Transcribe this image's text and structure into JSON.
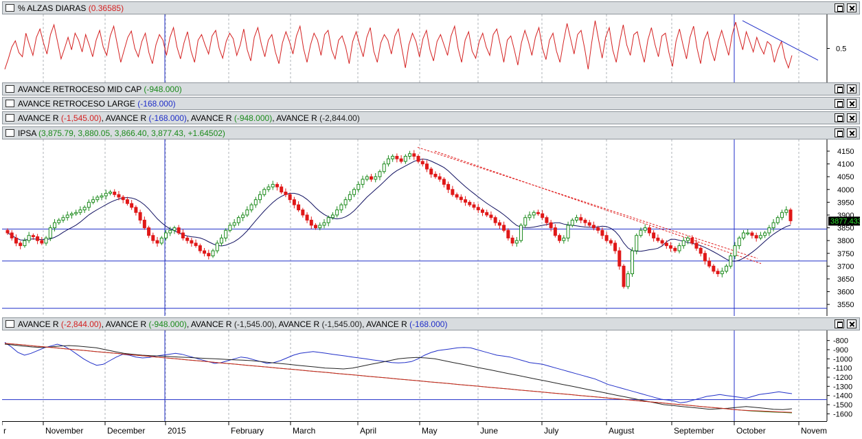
{
  "panes": {
    "alzas": {
      "check": "",
      "title_prefix": "% ",
      "title_name": "ALZAS DIARAS",
      "title_value": "(0.36585)",
      "axis_label": "0.5"
    },
    "mid": {
      "title_name": "AVANCE RETROCESO MID CAP",
      "title_value": "(-948.000)"
    },
    "large": {
      "title_name": "AVANCE RETROCESO LARGE",
      "title_value": "(-168.000)"
    },
    "multi": {
      "items": [
        {
          "name": "AVANCE R",
          "value": "(-1,545.00)",
          "color": "#d42020"
        },
        {
          "name": "AVANCE R",
          "value": "(-168.000)",
          "color": "#1f2ec8"
        },
        {
          "name": "AVANCE R",
          "value": "(-948.000)",
          "color": "#1b8a1b"
        },
        {
          "name": "AVANCE R",
          "value": "(-2,844.00)",
          "color": "#222222"
        }
      ]
    },
    "ipsa": {
      "title_name": "IPSA",
      "title_value": "(3,875.79, 3,880.05, 3,866.40, 3,877.43, +1.64502)",
      "last_price": "3877.433"
    },
    "avance": {
      "items": [
        {
          "name": "AVANCE R",
          "value": "(-2,844.00)",
          "color": "#d42020"
        },
        {
          "name": "AVANCE R",
          "value": "(-948.000)",
          "color": "#1b8a1b"
        },
        {
          "name": "AVANCE R",
          "value": "(-1,545.00)",
          "color": "#222222"
        },
        {
          "name": "AVANCE R",
          "value": "(-1,545.00)",
          "color": "#222222"
        },
        {
          "name": "AVANCE R",
          "value": "(-168.000)",
          "color": "#1f2ec8"
        }
      ]
    }
  },
  "x_axis": {
    "labels": [
      "r",
      "November",
      "December",
      "2015",
      "February",
      "March",
      "April",
      "May",
      "June",
      "July",
      "August",
      "September",
      "October",
      "Novem"
    ]
  },
  "colors": {
    "up": "#1b8a1b",
    "down": "#e01818",
    "ma": "#101060",
    "hline": "#1f2ec8",
    "trend": "#e02020"
  },
  "chart_data": [
    {
      "type": "line",
      "title": "% ALZAS DIARAS (0.36585)",
      "ylim": [
        0.05,
        0.95
      ],
      "yticks": [
        0.5
      ],
      "series": [
        {
          "name": "% ALZAS DIARAS",
          "color": "#d42020",
          "values": [
            0.2,
            0.35,
            0.52,
            0.61,
            0.44,
            0.38,
            0.72,
            0.55,
            0.4,
            0.66,
            0.78,
            0.58,
            0.42,
            0.7,
            0.84,
            0.6,
            0.35,
            0.5,
            0.66,
            0.48,
            0.72,
            0.62,
            0.45,
            0.7,
            0.55,
            0.38,
            0.62,
            0.76,
            0.52,
            0.4,
            0.68,
            0.82,
            0.56,
            0.3,
            0.48,
            0.66,
            0.75,
            0.5,
            0.38,
            0.6,
            0.72,
            0.44,
            0.28,
            0.55,
            0.7,
            0.62,
            0.4,
            0.66,
            0.8,
            0.52,
            0.35,
            0.58,
            0.74,
            0.46,
            0.3,
            0.62,
            0.7,
            0.55,
            0.42,
            0.68,
            0.76,
            0.5,
            0.36,
            0.6,
            0.72,
            0.64,
            0.4,
            0.55,
            0.78,
            0.48,
            0.32,
            0.66,
            0.8,
            0.56,
            0.38,
            0.62,
            0.7,
            0.45,
            0.28,
            0.58,
            0.74,
            0.6,
            0.42,
            0.68,
            0.82,
            0.5,
            0.3,
            0.55,
            0.72,
            0.62,
            0.4,
            0.7,
            0.76,
            0.48,
            0.35,
            0.62,
            0.68,
            0.52,
            0.28,
            0.6,
            0.74,
            0.55,
            0.38,
            0.66,
            0.8,
            0.46,
            0.3,
            0.58,
            0.7,
            0.62,
            0.42,
            0.68,
            0.78,
            0.5,
            0.22,
            0.55,
            0.72,
            0.6,
            0.38,
            0.64,
            0.76,
            0.48,
            0.32,
            0.6,
            0.7,
            0.55,
            0.4,
            0.68,
            0.82,
            0.5,
            0.3,
            0.62,
            0.74,
            0.46,
            0.36,
            0.6,
            0.72,
            0.52,
            0.4,
            0.7,
            0.78,
            0.55,
            0.3,
            0.62,
            0.68,
            0.48,
            0.26,
            0.58,
            0.76,
            0.6,
            0.4,
            0.66,
            0.8,
            0.5,
            0.34,
            0.62,
            0.72,
            0.46,
            0.3,
            0.6,
            0.86,
            0.64,
            0.42,
            0.7,
            0.76,
            0.5,
            0.2,
            0.58,
            0.9,
            0.62,
            0.36,
            0.66,
            0.8,
            0.48,
            0.3,
            0.6,
            0.84,
            0.55,
            0.4,
            0.7,
            0.74,
            0.5,
            0.3,
            0.62,
            0.8,
            0.56,
            0.38,
            0.68,
            0.72,
            0.44,
            0.24,
            0.6,
            0.78,
            0.55,
            0.35,
            0.66,
            0.82,
            0.5,
            0.28,
            0.62,
            0.74,
            0.48,
            0.32,
            0.6,
            0.76,
            0.58,
            0.4,
            0.7,
            0.88,
            0.66,
            0.48,
            0.74,
            0.6,
            0.45,
            0.66,
            0.52,
            0.42,
            0.6,
            0.55,
            0.3,
            0.48,
            0.6,
            0.36,
            0.22,
            0.4
          ]
        }
      ],
      "trendline": {
        "from": 0.9,
        "to": 0.45
      }
    },
    {
      "type": "candlestick",
      "title": "IPSA",
      "ylim": [
        3510,
        4185
      ],
      "yticks": [
        3550,
        3600,
        3650,
        3700,
        3750,
        3800,
        3850,
        3900,
        3950,
        4000,
        4050,
        4100,
        4150
      ],
      "hlines": [
        3845,
        3720,
        3535
      ],
      "close": [
        3830,
        3810,
        3790,
        3780,
        3800,
        3820,
        3815,
        3800,
        3790,
        3810,
        3850,
        3870,
        3880,
        3890,
        3900,
        3905,
        3910,
        3920,
        3930,
        3950,
        3960,
        3970,
        3975,
        3985,
        3990,
        3980,
        3970,
        3960,
        3945,
        3930,
        3910,
        3880,
        3850,
        3820,
        3800,
        3790,
        3810,
        3830,
        3840,
        3850,
        3830,
        3810,
        3800,
        3790,
        3780,
        3760,
        3750,
        3740,
        3760,
        3790,
        3810,
        3840,
        3860,
        3870,
        3890,
        3900,
        3920,
        3940,
        3960,
        3980,
        4000,
        4010,
        4020,
        4010,
        3990,
        3980,
        3960,
        3940,
        3920,
        3900,
        3880,
        3860,
        3850,
        3860,
        3870,
        3890,
        3900,
        3920,
        3940,
        3960,
        3980,
        4000,
        4020,
        4040,
        4050,
        4040,
        4050,
        4070,
        4100,
        4120,
        4130,
        4120,
        4110,
        4130,
        4140,
        4130,
        4110,
        4100,
        4080,
        4060,
        4050,
        4040,
        4020,
        4000,
        3980,
        3970,
        3960,
        3950,
        3940,
        3930,
        3920,
        3910,
        3900,
        3890,
        3870,
        3860,
        3840,
        3810,
        3790,
        3800,
        3860,
        3890,
        3900,
        3910,
        3905,
        3890,
        3870,
        3850,
        3820,
        3800,
        3810,
        3860,
        3880,
        3890,
        3880,
        3870,
        3860,
        3850,
        3840,
        3820,
        3800,
        3790,
        3760,
        3700,
        3620,
        3670,
        3760,
        3820,
        3840,
        3850,
        3830,
        3810,
        3800,
        3790,
        3780,
        3770,
        3760,
        3780,
        3800,
        3810,
        3790,
        3770,
        3750,
        3720,
        3700,
        3680,
        3670,
        3680,
        3700,
        3740,
        3780,
        3810,
        3830,
        3830,
        3820,
        3810,
        3820,
        3830,
        3850,
        3870,
        3890,
        3910,
        3920,
        3877.43
      ]
    },
    {
      "type": "line",
      "title": "AVANCE R",
      "ylim": [
        -1650,
        -720
      ],
      "yticks": [
        -800,
        -900,
        -1000,
        -1100,
        -1200,
        -1300,
        -1400,
        -1500,
        -1600
      ],
      "hlines": [
        -1445
      ],
      "series": [
        {
          "name": "AVANCE R",
          "color": "#1f2ec8",
          "values": [
            -820,
            -870,
            -930,
            -960,
            -940,
            -910,
            -880,
            -860,
            -840,
            -860,
            -900,
            -950,
            -1000,
            -1040,
            -1070,
            -1060,
            -1020,
            -980,
            -950,
            -960,
            -980,
            -990,
            -985,
            -970,
            -960,
            -950,
            -940,
            -950,
            -970,
            -990,
            -1010,
            -1030,
            -1050,
            -1040,
            -1020,
            -1000,
            -980,
            -990,
            -1010,
            -1030,
            -1050,
            -1040,
            -1020,
            -990,
            -960,
            -940,
            -930,
            -920,
            -930,
            -940,
            -950,
            -960,
            -970,
            -980,
            -990,
            -1000,
            -1010,
            -1020,
            -1030,
            -1040,
            -1045,
            -1040,
            -1030,
            -1000,
            -960,
            -930,
            -910,
            -900,
            -890,
            -880,
            -875,
            -880,
            -900,
            -920,
            -940,
            -960,
            -970,
            -980,
            -1000,
            -1020,
            -1040,
            -1050,
            -1060,
            -1080,
            -1100,
            -1120,
            -1140,
            -1160,
            -1180,
            -1200,
            -1220,
            -1250,
            -1280,
            -1300,
            -1320,
            -1340,
            -1360,
            -1380,
            -1400,
            -1420,
            -1440,
            -1450,
            -1460,
            -1480,
            -1470,
            -1450,
            -1430,
            -1410,
            -1400,
            -1390,
            -1400,
            -1410,
            -1420,
            -1430,
            -1410,
            -1390,
            -1380,
            -1370,
            -1360,
            -1370,
            -1380
          ]
        },
        {
          "name": "AVANCE R",
          "color": "#222222",
          "values": [
            -840,
            -850,
            -860,
            -870,
            -875,
            -870,
            -860,
            -855,
            -860,
            -870,
            -880,
            -900,
            -920,
            -940,
            -950,
            -960,
            -965,
            -970,
            -975,
            -980,
            -985,
            -990,
            -995,
            -1000,
            -1005,
            -1010,
            -1015,
            -1020,
            -1030,
            -1040,
            -1050,
            -1060,
            -1070,
            -1080,
            -1090,
            -1100,
            -1105,
            -1110,
            -1100,
            -1080,
            -1060,
            -1040,
            -1020,
            -1000,
            -990,
            -985,
            -990,
            -1000,
            -1020,
            -1040,
            -1060,
            -1080,
            -1100,
            -1120,
            -1140,
            -1160,
            -1180,
            -1200,
            -1220,
            -1240,
            -1260,
            -1280,
            -1300,
            -1320,
            -1340,
            -1360,
            -1380,
            -1400,
            -1420,
            -1440,
            -1460,
            -1480,
            -1500,
            -1510,
            -1520,
            -1530,
            -1540,
            -1550,
            -1545,
            -1540,
            -1530,
            -1520,
            -1530,
            -1540,
            -1550,
            -1555,
            -1545
          ]
        },
        {
          "name": "AVANCE R",
          "color": "#1b8a1b",
          "values": [
            -830,
            -840,
            -850,
            -860,
            -870,
            -880,
            -890,
            -900,
            -910,
            -920,
            -930,
            -940,
            -950,
            -960,
            -970,
            -980,
            -990,
            -1000,
            -1010,
            -1020,
            -1030,
            -1040,
            -1050,
            -1060,
            -1070,
            -1080,
            -1090,
            -1100,
            -1110,
            -1120,
            -1130,
            -1140,
            -1150,
            -1160,
            -1170,
            -1180,
            -1190,
            -1200,
            -1210,
            -1220,
            -1230,
            -1240,
            -1250,
            -1260,
            -1270,
            -1280,
            -1290,
            -1300,
            -1310,
            -1320,
            -1330,
            -1340,
            -1350,
            -1360,
            -1370,
            -1380,
            -1390,
            -1400,
            -1410,
            -1420,
            -1430,
            -1440,
            -1450,
            -1460,
            -1470,
            -1480,
            -1490,
            -1500,
            -1510,
            -1520,
            -1530,
            -1540,
            -1550,
            -1560,
            -1570,
            -1575,
            -1580,
            -1585,
            -1590
          ]
        },
        {
          "name": "AVANCE R",
          "color": "#d42020",
          "values": [
            -830,
            -840,
            -850,
            -860,
            -870,
            -880,
            -890,
            -900,
            -910,
            -920,
            -930,
            -940,
            -950,
            -960,
            -970,
            -980,
            -990,
            -1000,
            -1010,
            -1020,
            -1030,
            -1040,
            -1050,
            -1060,
            -1070,
            -1080,
            -1090,
            -1100,
            -1110,
            -1120,
            -1130,
            -1140,
            -1150,
            -1160,
            -1170,
            -1180,
            -1190,
            -1200,
            -1210,
            -1220,
            -1230,
            -1240,
            -1250,
            -1260,
            -1270,
            -1280,
            -1290,
            -1300,
            -1310,
            -1320,
            -1330,
            -1340,
            -1350,
            -1360,
            -1370,
            -1380,
            -1390,
            -1400,
            -1410,
            -1420,
            -1430,
            -1440,
            -1450,
            -1460,
            -1470,
            -1480,
            -1490,
            -1500,
            -1510,
            -1520,
            -1530,
            -1540,
            -1550,
            -1560,
            -1565,
            -1570,
            -1575,
            -1580,
            -1585
          ]
        }
      ]
    }
  ]
}
